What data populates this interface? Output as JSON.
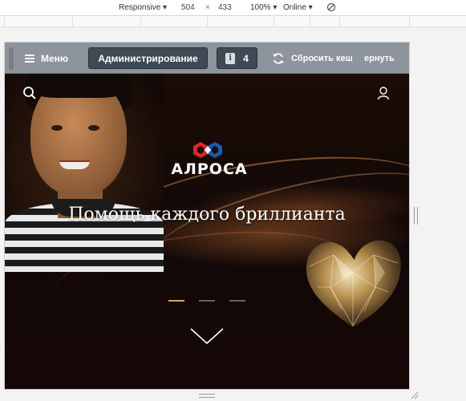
{
  "devtools": {
    "device_label": "Responsive ▾",
    "width": "504",
    "times": "×",
    "height": "433",
    "zoom_label": "100% ▾",
    "network_label": "Online ▾"
  },
  "admin_bar": {
    "menu_label": "Меню",
    "admin_label": "Администрирование",
    "notif_count": "4",
    "cache_label": "Сбросить кеш",
    "return_label": "ернуть"
  },
  "hero": {
    "logo_text": "АЛРОСА",
    "headline": "Помощь каждого бриллианта",
    "slides_count": 3,
    "active_slide": 1
  },
  "colors": {
    "admin_bar": "#8d949b",
    "admin_button": "#3f4a55",
    "dot_active": "#e0a070",
    "logo_red": "#d9262f",
    "logo_blue": "#1e5aa8"
  },
  "icons": [
    "hamburger-icon",
    "notification-icon",
    "refresh-icon",
    "search-icon",
    "user-icon",
    "chevron-down-icon",
    "no-throttle-icon"
  ]
}
